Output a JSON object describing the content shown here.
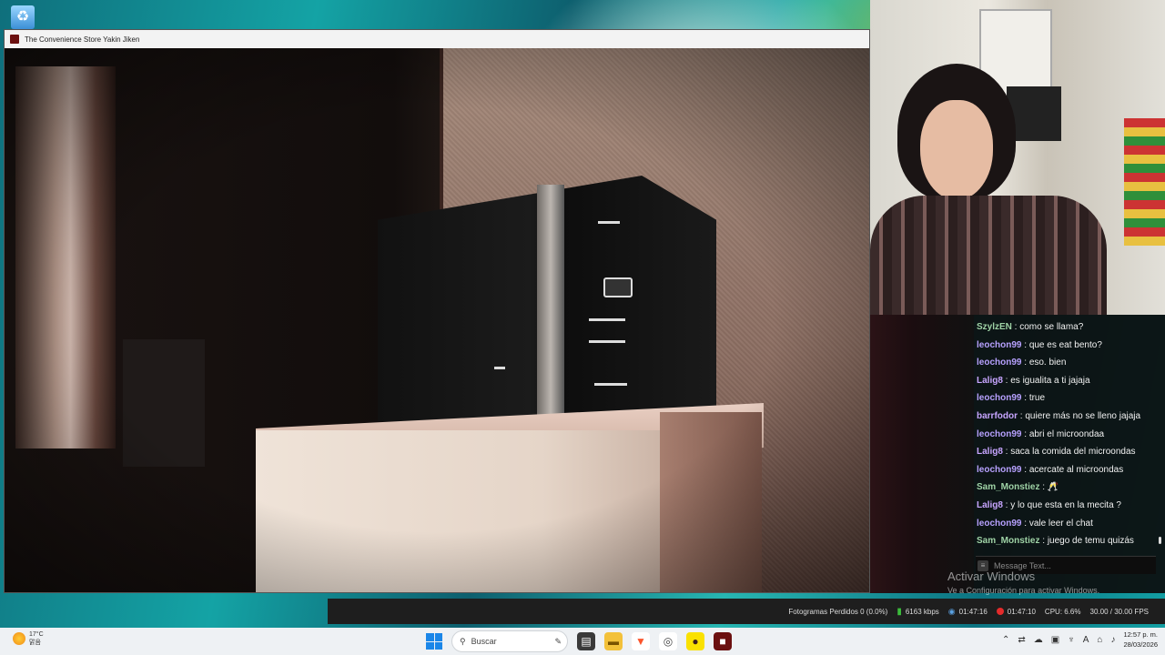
{
  "window": {
    "title": "The Convenience Store Yakin Jiken"
  },
  "chat": {
    "messages": [
      {
        "user": "SzylzEN",
        "text": "como se llama?",
        "color": "#9fd3a6"
      },
      {
        "user": "leochon99",
        "text": "que es eat bento?",
        "color": "#b7a1ff"
      },
      {
        "user": "leochon99",
        "text": "eso. bien",
        "color": "#b7a1ff"
      },
      {
        "user": "Lalig8",
        "text": "es igualita a ti jajaja",
        "color": "#c7a5ff"
      },
      {
        "user": "leochon99",
        "text": "true",
        "color": "#b7a1ff"
      },
      {
        "user": "barrfodor",
        "text": "quiere más no se lleno jajaja",
        "color": "#c7a5ff"
      },
      {
        "user": "leochon99",
        "text": "abri el microondaa",
        "color": "#b7a1ff"
      },
      {
        "user": "Lalig8",
        "text": "saca la comida del microondas",
        "color": "#c7a5ff"
      },
      {
        "user": "leochon99",
        "text": "acercate al microondas",
        "color": "#b7a1ff"
      },
      {
        "user": "Sam_Monstiez",
        "text": "🥂",
        "color": "#9fd3a6"
      },
      {
        "user": "Lalig8",
        "text": "y lo que esta en la mecita ?",
        "color": "#c7a5ff"
      },
      {
        "user": "leochon99",
        "text": "vale leer el chat",
        "color": "#b7a1ff"
      },
      {
        "user": "Sam_Monstiez",
        "text": "juego de temu quizás",
        "color": "#9fd3a6"
      }
    ],
    "separator": " : ",
    "input_placeholder": "Message Text..."
  },
  "activation": {
    "title": "Activar Windows",
    "subtitle": "Ve a Configuración para activar Windows."
  },
  "obs": {
    "dropped_frames": "Fotogramas Perdidos 0 (0.0%)",
    "bitrate": "6163 kbps",
    "live_time": "01:47:16",
    "rec_time": "01:47:10",
    "cpu": "CPU: 6.6%",
    "fps": "30.00 / 30.00 FPS"
  },
  "taskbar": {
    "weather_temp": "17°C",
    "weather_desc": "맑음",
    "search_label": "Buscar",
    "time": "12:57 p. m.",
    "date": "28/03/2026",
    "apps": [
      "file-explorer",
      "brave-browser",
      "chrome",
      "kakaotalk",
      "game-app"
    ]
  },
  "colors": {
    "accent_windows": "#1a86e8",
    "rec_red": "#e52b2b",
    "signal_green": "#3bbd3b"
  }
}
